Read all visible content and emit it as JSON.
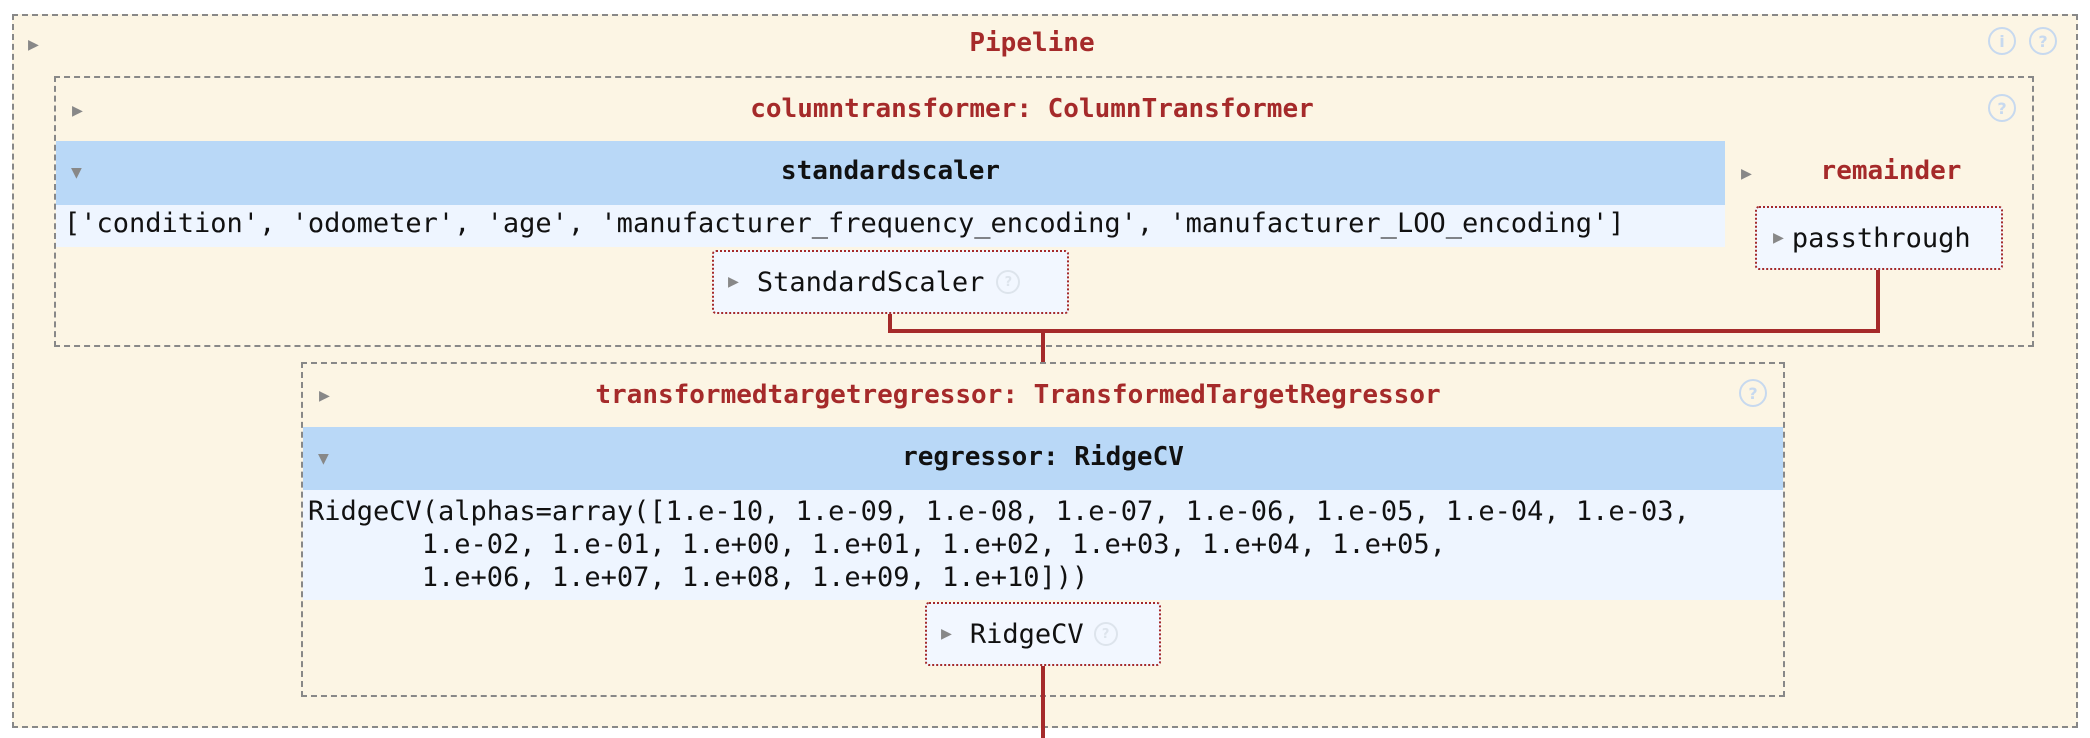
{
  "pipeline": {
    "label": "Pipeline",
    "info_icon": "i",
    "help_icon": "?"
  },
  "column_transformer": {
    "label": "columntransformer: ColumnTransformer",
    "help_icon": "?",
    "standardscaler": {
      "label": "standardscaler",
      "columns": "['condition', 'odometer', 'age', 'manufacturer_frequency_encoding', 'manufacturer_LOO_encoding']",
      "estimator_label": "StandardScaler",
      "help_icon": "?"
    },
    "remainder": {
      "label": "remainder",
      "estimator_label": "passthrough"
    }
  },
  "transformed_target_regressor": {
    "label": "transformedtargetregressor: TransformedTargetRegressor",
    "help_icon": "?",
    "regressor": {
      "label": "regressor: RidgeCV",
      "params": "RidgeCV(alphas=array([1.e-10, 1.e-09, 1.e-08, 1.e-07, 1.e-06, 1.e-05, 1.e-04, 1.e-03,\n       1.e-02, 1.e-01, 1.e+00, 1.e+01, 1.e+02, 1.e+03, 1.e+04, 1.e+05,\n       1.e+06, 1.e+07, 1.e+08, 1.e+09, 1.e+10]))",
      "estimator_label": "RidgeCV",
      "help_icon": "?"
    }
  },
  "icons": {
    "collapsed_arrow": "▶",
    "expanded_arrow": "▼"
  },
  "colors": {
    "background": "#fcf5e4",
    "title_red": "#a52a2a",
    "header_blue": "#b9d8f7",
    "param_blue": "#eef5ff",
    "connector": "#a52a2a"
  }
}
